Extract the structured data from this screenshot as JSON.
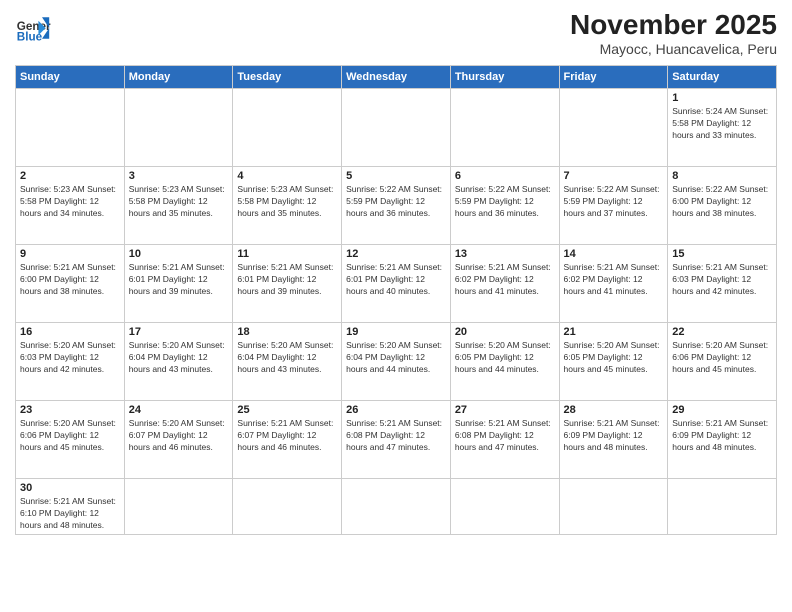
{
  "logo": {
    "general": "General",
    "blue": "Blue"
  },
  "title": "November 2025",
  "subtitle": "Mayocc, Huancavelica, Peru",
  "days_of_week": [
    "Sunday",
    "Monday",
    "Tuesday",
    "Wednesday",
    "Thursday",
    "Friday",
    "Saturday"
  ],
  "weeks": [
    [
      {
        "day": "",
        "info": ""
      },
      {
        "day": "",
        "info": ""
      },
      {
        "day": "",
        "info": ""
      },
      {
        "day": "",
        "info": ""
      },
      {
        "day": "",
        "info": ""
      },
      {
        "day": "",
        "info": ""
      },
      {
        "day": "1",
        "info": "Sunrise: 5:24 AM\nSunset: 5:58 PM\nDaylight: 12 hours and 33 minutes."
      }
    ],
    [
      {
        "day": "2",
        "info": "Sunrise: 5:23 AM\nSunset: 5:58 PM\nDaylight: 12 hours and 34 minutes."
      },
      {
        "day": "3",
        "info": "Sunrise: 5:23 AM\nSunset: 5:58 PM\nDaylight: 12 hours and 35 minutes."
      },
      {
        "day": "4",
        "info": "Sunrise: 5:23 AM\nSunset: 5:58 PM\nDaylight: 12 hours and 35 minutes."
      },
      {
        "day": "5",
        "info": "Sunrise: 5:22 AM\nSunset: 5:59 PM\nDaylight: 12 hours and 36 minutes."
      },
      {
        "day": "6",
        "info": "Sunrise: 5:22 AM\nSunset: 5:59 PM\nDaylight: 12 hours and 36 minutes."
      },
      {
        "day": "7",
        "info": "Sunrise: 5:22 AM\nSunset: 5:59 PM\nDaylight: 12 hours and 37 minutes."
      },
      {
        "day": "8",
        "info": "Sunrise: 5:22 AM\nSunset: 6:00 PM\nDaylight: 12 hours and 38 minutes."
      }
    ],
    [
      {
        "day": "9",
        "info": "Sunrise: 5:21 AM\nSunset: 6:00 PM\nDaylight: 12 hours and 38 minutes."
      },
      {
        "day": "10",
        "info": "Sunrise: 5:21 AM\nSunset: 6:01 PM\nDaylight: 12 hours and 39 minutes."
      },
      {
        "day": "11",
        "info": "Sunrise: 5:21 AM\nSunset: 6:01 PM\nDaylight: 12 hours and 39 minutes."
      },
      {
        "day": "12",
        "info": "Sunrise: 5:21 AM\nSunset: 6:01 PM\nDaylight: 12 hours and 40 minutes."
      },
      {
        "day": "13",
        "info": "Sunrise: 5:21 AM\nSunset: 6:02 PM\nDaylight: 12 hours and 41 minutes."
      },
      {
        "day": "14",
        "info": "Sunrise: 5:21 AM\nSunset: 6:02 PM\nDaylight: 12 hours and 41 minutes."
      },
      {
        "day": "15",
        "info": "Sunrise: 5:21 AM\nSunset: 6:03 PM\nDaylight: 12 hours and 42 minutes."
      }
    ],
    [
      {
        "day": "16",
        "info": "Sunrise: 5:20 AM\nSunset: 6:03 PM\nDaylight: 12 hours and 42 minutes."
      },
      {
        "day": "17",
        "info": "Sunrise: 5:20 AM\nSunset: 6:04 PM\nDaylight: 12 hours and 43 minutes."
      },
      {
        "day": "18",
        "info": "Sunrise: 5:20 AM\nSunset: 6:04 PM\nDaylight: 12 hours and 43 minutes."
      },
      {
        "day": "19",
        "info": "Sunrise: 5:20 AM\nSunset: 6:04 PM\nDaylight: 12 hours and 44 minutes."
      },
      {
        "day": "20",
        "info": "Sunrise: 5:20 AM\nSunset: 6:05 PM\nDaylight: 12 hours and 44 minutes."
      },
      {
        "day": "21",
        "info": "Sunrise: 5:20 AM\nSunset: 6:05 PM\nDaylight: 12 hours and 45 minutes."
      },
      {
        "day": "22",
        "info": "Sunrise: 5:20 AM\nSunset: 6:06 PM\nDaylight: 12 hours and 45 minutes."
      }
    ],
    [
      {
        "day": "23",
        "info": "Sunrise: 5:20 AM\nSunset: 6:06 PM\nDaylight: 12 hours and 45 minutes."
      },
      {
        "day": "24",
        "info": "Sunrise: 5:20 AM\nSunset: 6:07 PM\nDaylight: 12 hours and 46 minutes."
      },
      {
        "day": "25",
        "info": "Sunrise: 5:21 AM\nSunset: 6:07 PM\nDaylight: 12 hours and 46 minutes."
      },
      {
        "day": "26",
        "info": "Sunrise: 5:21 AM\nSunset: 6:08 PM\nDaylight: 12 hours and 47 minutes."
      },
      {
        "day": "27",
        "info": "Sunrise: 5:21 AM\nSunset: 6:08 PM\nDaylight: 12 hours and 47 minutes."
      },
      {
        "day": "28",
        "info": "Sunrise: 5:21 AM\nSunset: 6:09 PM\nDaylight: 12 hours and 48 minutes."
      },
      {
        "day": "29",
        "info": "Sunrise: 5:21 AM\nSunset: 6:09 PM\nDaylight: 12 hours and 48 minutes."
      }
    ],
    [
      {
        "day": "30",
        "info": "Sunrise: 5:21 AM\nSunset: 6:10 PM\nDaylight: 12 hours and 48 minutes."
      },
      {
        "day": "",
        "info": ""
      },
      {
        "day": "",
        "info": ""
      },
      {
        "day": "",
        "info": ""
      },
      {
        "day": "",
        "info": ""
      },
      {
        "day": "",
        "info": ""
      },
      {
        "day": "",
        "info": ""
      }
    ]
  ]
}
